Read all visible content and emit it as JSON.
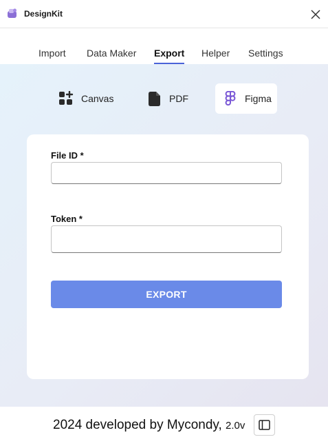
{
  "window": {
    "title": "DesignKit",
    "logo_icon": "designkit-logo-icon",
    "close_icon": "close-icon"
  },
  "tabs": [
    {
      "label": "Import",
      "active": false
    },
    {
      "label": "Data Maker",
      "active": false
    },
    {
      "label": "Export",
      "active": true
    },
    {
      "label": "Helper",
      "active": false
    },
    {
      "label": "Settings",
      "active": false
    }
  ],
  "export_types": [
    {
      "label": "Canvas",
      "icon": "canvas-grid-plus-icon",
      "selected": false
    },
    {
      "label": "PDF",
      "icon": "document-icon",
      "selected": false
    },
    {
      "label": "Figma",
      "icon": "figma-icon",
      "selected": true
    }
  ],
  "form": {
    "file_id": {
      "label": "File ID *",
      "value": "",
      "placeholder": ""
    },
    "token": {
      "label": "Token *",
      "value": "",
      "placeholder": ""
    },
    "export_button": "EXPORT"
  },
  "footer": {
    "credit": "2024 developed by Mycondy,",
    "version": "2.0v",
    "panel_icon": "sidebar-panel-icon"
  },
  "colors": {
    "accent": "#4a63d8",
    "export_button": "#6a8ae8",
    "figma_icon": "#7a58d6"
  }
}
